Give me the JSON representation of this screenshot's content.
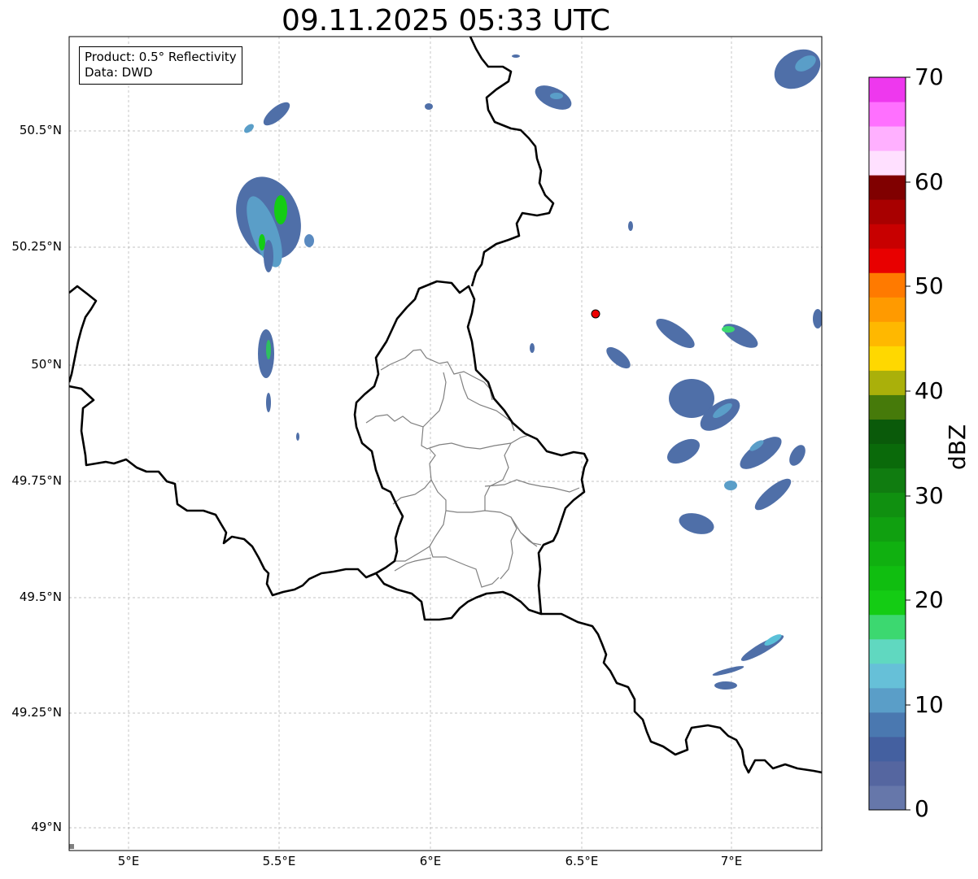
{
  "title": "09.11.2025 05:33 UTC",
  "product_box": {
    "line1": "Product: 0.5° Reflectivity",
    "line2": "Data: DWD"
  },
  "axes": {
    "lat_labels": [
      "50.5°N",
      "50.25°N",
      "50°N",
      "49.75°N",
      "49.5°N",
      "49.25°N",
      "49°N"
    ],
    "lon_labels": [
      "5°E",
      "5.5°E",
      "6°E",
      "6.5°E",
      "7°E"
    ],
    "lat_values": [
      50.5,
      50.25,
      50.0,
      49.75,
      49.5,
      49.25,
      49.0
    ],
    "lon_values": [
      5.0,
      5.5,
      6.0,
      6.5,
      7.0
    ],
    "lon_range": [
      4.8,
      7.3
    ],
    "lat_range": [
      48.95,
      50.7
    ],
    "grid": true
  },
  "colorbar": {
    "label": "dBZ",
    "ticks": [
      "0",
      "10",
      "20",
      "30",
      "40",
      "50",
      "60",
      "70"
    ],
    "min": 0,
    "max": 70,
    "colors": [
      "#6677aa",
      "#5566a0",
      "#4460a0",
      "#4a78b0",
      "#5a9ec8",
      "#66c0d8",
      "#60d8c0",
      "#3cd870",
      "#14cc14",
      "#10be10",
      "#10b010",
      "#10a010",
      "#109010",
      "#107c10",
      "#0a6a0a",
      "#0a5a0a",
      "#467a0a",
      "#aab00a",
      "#ffd800",
      "#ffb800",
      "#ff9a00",
      "#ff7a00",
      "#e80000",
      "#c80000",
      "#a80000",
      "#800000",
      "#ffe0ff",
      "#ffb0ff",
      "#ff70ff",
      "#ee38ee"
    ]
  },
  "radar_marker": {
    "lon": 6.55,
    "lat": 50.11,
    "color": "#ee0000"
  },
  "echoes_dbz_note": "",
  "borders": {
    "country_color": "#000000",
    "district_color": "#808080"
  }
}
